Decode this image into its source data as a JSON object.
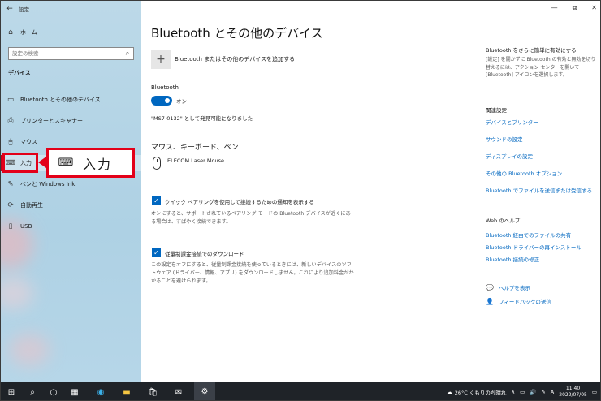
{
  "window": {
    "app_title": "設定",
    "controls": {
      "minimize": "—",
      "maximize": "⧉",
      "close": "✕"
    }
  },
  "sidebar": {
    "home_label": "ホーム",
    "search_placeholder": "設定の検索",
    "section_title": "デバイス",
    "items": [
      {
        "label": "Bluetooth とその他のデバイス",
        "icon": "bluetooth-devices-icon",
        "glyph": "▭"
      },
      {
        "label": "プリンターとスキャナー",
        "icon": "printer-icon",
        "glyph": "⎙"
      },
      {
        "label": "マウス",
        "icon": "mouse-icon",
        "glyph": "🖱"
      },
      {
        "label": "入力",
        "icon": "keyboard-icon",
        "glyph": "⌨"
      },
      {
        "label": "ペンと Windows Ink",
        "icon": "pen-icon",
        "glyph": "✎"
      },
      {
        "label": "自動再生",
        "icon": "autoplay-icon",
        "glyph": "⟳"
      },
      {
        "label": "USB",
        "icon": "usb-icon",
        "glyph": "▯"
      }
    ]
  },
  "callout": {
    "label": "入力",
    "icon": "keyboard-icon"
  },
  "main": {
    "title": "Bluetooth とその他のデバイス",
    "add_device_label": "Bluetooth またはその他のデバイスを追加する",
    "bluetooth_label": "Bluetooth",
    "toggle_state": "オン",
    "discoverable_text": "\"MS7-0132\" として発見可能になりました",
    "mouse_section_title": "マウス、キーボード、ペン",
    "mouse_device": "ELECOM Laser Mouse",
    "swift_pair_label": "クイック ペアリングを使用して接続するための通知を表示する",
    "swift_pair_desc": "オンにすると、サポートされているペアリング モードの Bluetooth デバイスが近くにある場合は、すばやく接続できます。",
    "metered_label": "従量制課金接続でのダウンロード",
    "metered_desc": "この設定をオフにすると、従量制課金接続を使っているときには、新しいデバイスのソフトウェア (ドライバー、情報、アプリ) をダウンロードしません。これにより追加料金がかかることを避けられます。"
  },
  "right": {
    "easier_title": "Bluetooth をさらに簡単に有効にする",
    "easier_desc": "[設定] を開かずに Bluetooth の有効と無効を切り替えるには、アクション センターを開いて [Bluetooth] アイコンを選択します。",
    "related_title": "関連設定",
    "related_links": [
      "デバイスとプリンター",
      "サウンドの設定",
      "ディスプレイの設定",
      "その他の Bluetooth オプション",
      "Bluetooth でファイルを送信または受信する"
    ],
    "web_help_title": "Web のヘルプ",
    "web_links": [
      "Bluetooth 経由でのファイルの共有",
      "Bluetooth ドライバーの再インストール",
      "Bluetooth 接続の修正"
    ],
    "help_label": "ヘルプを表示",
    "feedback_label": "フィードバックの送信"
  },
  "taskbar": {
    "weather": "26°C くもりのち晴れ",
    "ime": "A",
    "time": "11:40",
    "date": "2022/07/05",
    "apps": [
      "start-icon",
      "search-icon",
      "task-view-icon",
      "widgets-icon",
      "edge-icon",
      "explorer-icon",
      "store-icon",
      "mail-icon",
      "settings-icon"
    ]
  },
  "colors": {
    "accent": "#0067c0",
    "highlight": "#e30019",
    "taskbar": "#1f2328"
  }
}
